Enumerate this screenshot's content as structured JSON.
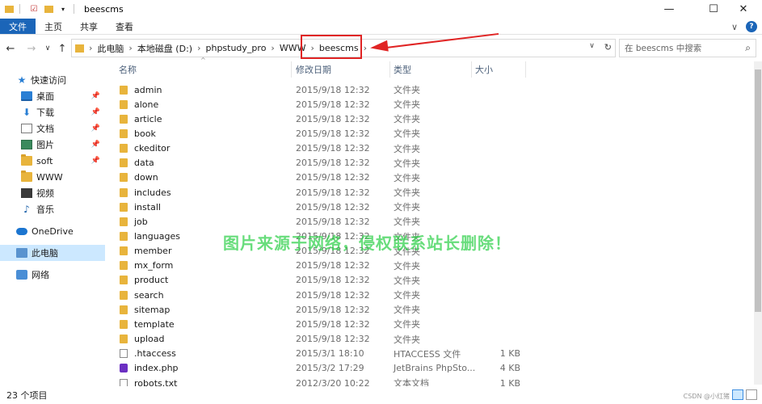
{
  "window": {
    "title": "beescms",
    "controls": {
      "minimize": "—",
      "maximize": "☐",
      "close": "✕"
    }
  },
  "ribbon": {
    "tabs": [
      {
        "label": "文件",
        "active": true
      },
      {
        "label": "主页"
      },
      {
        "label": "共享"
      },
      {
        "label": "查看"
      }
    ],
    "collapse": "∨",
    "help": "?"
  },
  "nav": {
    "back": "←",
    "forward": "→",
    "recent": "∨",
    "up": "↑"
  },
  "address": {
    "crumbs": [
      "此电脑",
      "本地磁盘 (D:)",
      "phpstudy_pro",
      "WWW",
      "beescms"
    ],
    "separator": "›",
    "dropdown": "∨",
    "refresh": "↻"
  },
  "search": {
    "placeholder": "在 beescms 中搜索",
    "icon": "search-icon"
  },
  "sidebar": {
    "items": [
      {
        "label": "快速访问",
        "icon": "star-icon"
      },
      {
        "label": "桌面",
        "icon": "desktop-icon",
        "pinned": true
      },
      {
        "label": "下载",
        "icon": "download-icon",
        "pinned": true
      },
      {
        "label": "文档",
        "icon": "document-icon",
        "pinned": true
      },
      {
        "label": "图片",
        "icon": "picture-icon",
        "pinned": true
      },
      {
        "label": "soft",
        "icon": "folder-icon",
        "pinned": true
      },
      {
        "label": "WWW",
        "icon": "folder-icon"
      },
      {
        "label": "视频",
        "icon": "video-icon"
      },
      {
        "label": "音乐",
        "icon": "music-icon"
      },
      {
        "label": "OneDrive",
        "icon": "cloud-icon"
      },
      {
        "label": "此电脑",
        "icon": "computer-icon",
        "selected": true
      },
      {
        "label": "网络",
        "icon": "network-icon"
      }
    ],
    "pin_glyph": "📌"
  },
  "columns": {
    "name": "名称",
    "date": "修改日期",
    "type": "类型",
    "size": "大小"
  },
  "files": [
    {
      "name": "admin",
      "date": "2015/9/18 12:32",
      "type": "文件夹",
      "size": "",
      "kind": "folder"
    },
    {
      "name": "alone",
      "date": "2015/9/18 12:32",
      "type": "文件夹",
      "size": "",
      "kind": "folder"
    },
    {
      "name": "article",
      "date": "2015/9/18 12:32",
      "type": "文件夹",
      "size": "",
      "kind": "folder"
    },
    {
      "name": "book",
      "date": "2015/9/18 12:32",
      "type": "文件夹",
      "size": "",
      "kind": "folder"
    },
    {
      "name": "ckeditor",
      "date": "2015/9/18 12:32",
      "type": "文件夹",
      "size": "",
      "kind": "folder"
    },
    {
      "name": "data",
      "date": "2015/9/18 12:32",
      "type": "文件夹",
      "size": "",
      "kind": "folder"
    },
    {
      "name": "down",
      "date": "2015/9/18 12:32",
      "type": "文件夹",
      "size": "",
      "kind": "folder"
    },
    {
      "name": "includes",
      "date": "2015/9/18 12:32",
      "type": "文件夹",
      "size": "",
      "kind": "folder"
    },
    {
      "name": "install",
      "date": "2015/9/18 12:32",
      "type": "文件夹",
      "size": "",
      "kind": "folder"
    },
    {
      "name": "job",
      "date": "2015/9/18 12:32",
      "type": "文件夹",
      "size": "",
      "kind": "folder"
    },
    {
      "name": "languages",
      "date": "2015/9/18 12:32",
      "type": "文件夹",
      "size": "",
      "kind": "folder"
    },
    {
      "name": "member",
      "date": "2015/9/18 12:32",
      "type": "文件夹",
      "size": "",
      "kind": "folder"
    },
    {
      "name": "mx_form",
      "date": "2015/9/18 12:32",
      "type": "文件夹",
      "size": "",
      "kind": "folder"
    },
    {
      "name": "product",
      "date": "2015/9/18 12:32",
      "type": "文件夹",
      "size": "",
      "kind": "folder"
    },
    {
      "name": "search",
      "date": "2015/9/18 12:32",
      "type": "文件夹",
      "size": "",
      "kind": "folder"
    },
    {
      "name": "sitemap",
      "date": "2015/9/18 12:32",
      "type": "文件夹",
      "size": "",
      "kind": "folder"
    },
    {
      "name": "template",
      "date": "2015/9/18 12:32",
      "type": "文件夹",
      "size": "",
      "kind": "folder"
    },
    {
      "name": "upload",
      "date": "2015/9/18 12:32",
      "type": "文件夹",
      "size": "",
      "kind": "folder"
    },
    {
      "name": ".htaccess",
      "date": "2015/3/1 18:10",
      "type": "HTACCESS 文件",
      "size": "1 KB",
      "kind": "file"
    },
    {
      "name": "index.php",
      "date": "2015/3/2 17:29",
      "type": "JetBrains PhpSto...",
      "size": "4 KB",
      "kind": "php"
    },
    {
      "name": "robots.txt",
      "date": "2012/3/20 10:22",
      "type": "文本文档",
      "size": "1 KB",
      "kind": "file"
    }
  ],
  "watermark": "图片来源于网络，侵权联系站长删除！",
  "status": {
    "count": "23 个项目"
  },
  "credit": "CSDN @小红猪"
}
